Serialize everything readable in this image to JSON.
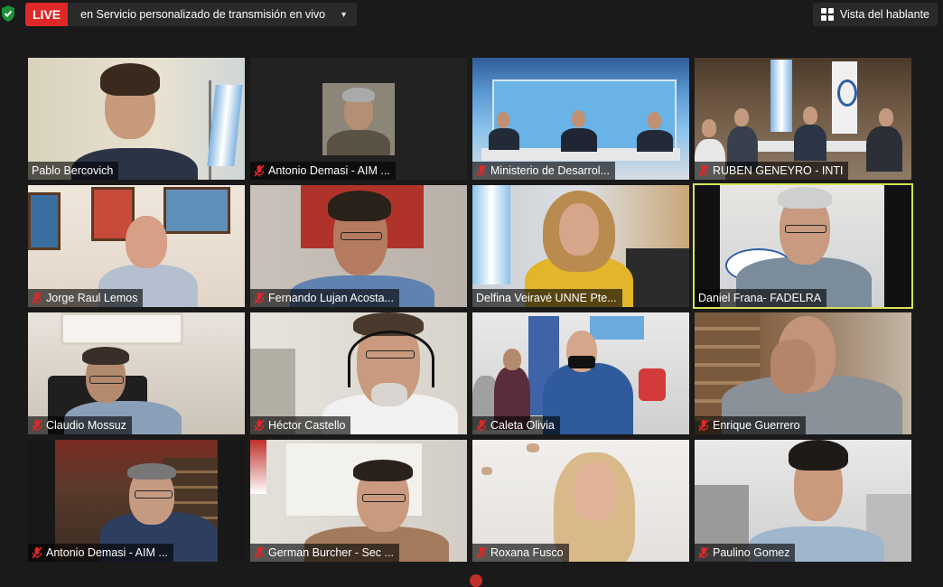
{
  "top_bar": {
    "live_label": "LIVE",
    "stream_label": "en Servicio personalizado de transmisión en vivo",
    "speaker_view_label": "Vista del hablante"
  },
  "colors": {
    "live": "#e02828",
    "active_speaker": "#d8e35a",
    "muted_icon": "#e02828"
  },
  "participants": [
    {
      "name": "Pablo Bercovich",
      "muted": false
    },
    {
      "name": "Antonio Demasi - AIM ...",
      "muted": true
    },
    {
      "name": "Ministerio de Desarrol...",
      "muted": true
    },
    {
      "name": "RUBEN GENEYRO - INTI",
      "muted": true
    },
    {
      "name": "Jorge Raul Lemos",
      "muted": true
    },
    {
      "name": "Fernando Lujan Acosta...",
      "muted": true
    },
    {
      "name": "Delfina Veiravé UNNE Pte...",
      "muted": false
    },
    {
      "name": "Daniel Frana- FADELRA",
      "muted": false,
      "active": true
    },
    {
      "name": "Claudio Mossuz",
      "muted": true
    },
    {
      "name": "Héctor Castello",
      "muted": true
    },
    {
      "name": "Caleta Olivia",
      "muted": true
    },
    {
      "name": "Enrique Guerrero",
      "muted": true
    },
    {
      "name": "Antonio Demasi - AIM ...",
      "muted": true
    },
    {
      "name": "German Burcher - Sec ...",
      "muted": true
    },
    {
      "name": "Roxana Fusco",
      "muted": true
    },
    {
      "name": "Paulino Gomez",
      "muted": true
    }
  ]
}
